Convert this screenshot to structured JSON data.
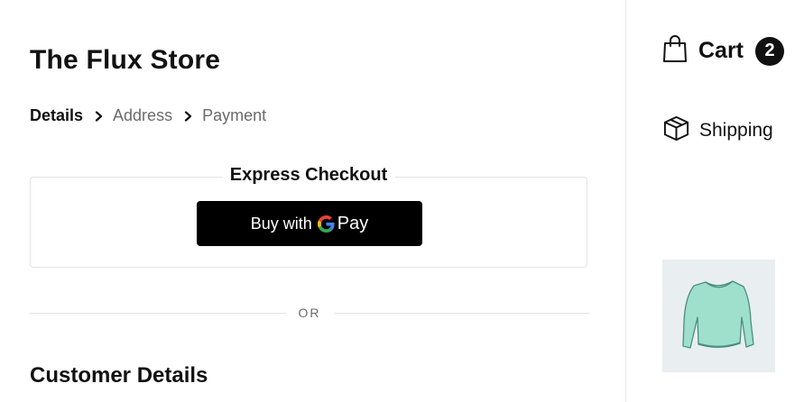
{
  "store": {
    "title": "The Flux Store"
  },
  "breadcrumb": {
    "items": [
      {
        "label": "Details",
        "active": true
      },
      {
        "label": "Address",
        "active": false
      },
      {
        "label": "Payment",
        "active": false
      }
    ]
  },
  "express": {
    "title": "Express Checkout",
    "button": {
      "prefix": "Buy with",
      "brand": "Pay"
    }
  },
  "divider": {
    "label": "OR"
  },
  "customer": {
    "title": "Customer Details"
  },
  "sidebar": {
    "cart": {
      "label": "Cart",
      "count": "2"
    },
    "shipping": {
      "label": "Shipping"
    },
    "product": {
      "icon": "sweater-image"
    }
  },
  "colors": {
    "text": "#111111",
    "muted": "#6b6b6b",
    "button_bg": "#000000",
    "border": "#e3e3e3",
    "thumb_bg": "#e9eef1",
    "sweater": "#9ee0cc"
  }
}
